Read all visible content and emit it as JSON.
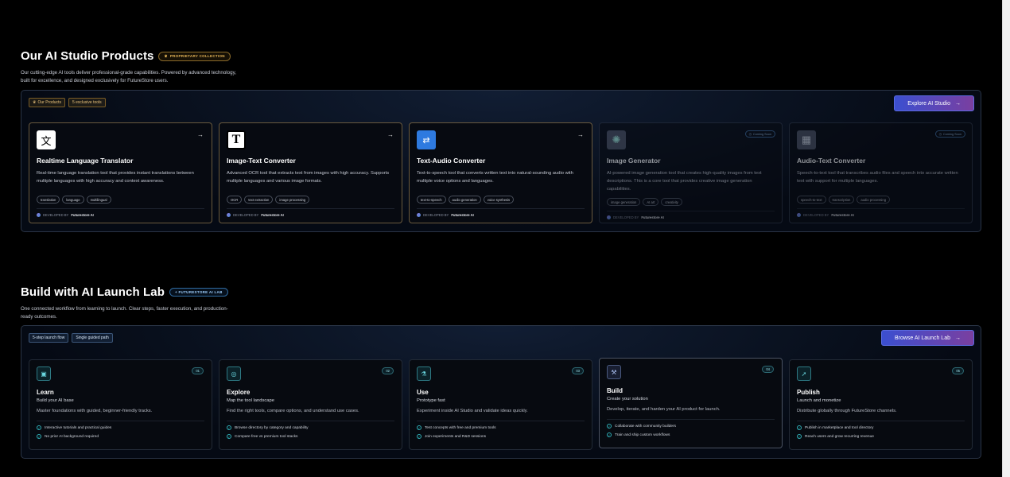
{
  "products": {
    "title": "Our AI Studio Products",
    "badge": "PROPRIETARY COLLECTION",
    "desc_line1": "Our cutting-edge AI tools deliver professional-grade capabilities. Powered by advanced technology,",
    "desc_line2": "built for excellence, and designed exclusively for FutureStore users.",
    "tag1": "Our Products",
    "tag2": "5 exclusive tools",
    "cta": "Explore AI Studio",
    "developed_by": "DEVELOPED BY",
    "developer": "Futurestore AI",
    "coming_soon": "Coming Soon",
    "cards": [
      {
        "title": "Realtime Language Translator",
        "desc": "Real-time language translation tool that provides instant translations between multiple languages with high accuracy and context awareness.",
        "chips": [
          "translation",
          "language",
          "multilingual"
        ],
        "icon": "translate-icon"
      },
      {
        "title": "Image-Text Converter",
        "desc": "Advanced OCR tool that extracts text from images with high accuracy. Supports multiple languages and various image formats.",
        "chips": [
          "OCR",
          "text extraction",
          "image processing"
        ],
        "icon": "ocr-text-icon"
      },
      {
        "title": "Text-Audio Converter",
        "desc": "Text-to-speech tool that converts written text into natural-sounding audio with multiple voice options and languages.",
        "chips": [
          "text-to-speech",
          "audio generation",
          "voice synthesis"
        ],
        "icon": "text-audio-icon"
      },
      {
        "title": "Image Generator",
        "desc": "AI-powered image generation tool that creates high-quality images from text descriptions. This is a core tool that provides creative image generation capabilities.",
        "chips": [
          "image generation",
          "AI art",
          "creativity"
        ],
        "icon": "image-gen-icon"
      },
      {
        "title": "Audio-Text Converter",
        "desc": "Speech-to-text tool that transcribes audio files and speech into accurate written text with support for multiple languages.",
        "chips": [
          "speech-to-text",
          "transcription",
          "audio processing"
        ],
        "icon": "audio-text-icon"
      }
    ]
  },
  "lab": {
    "title": "Build with AI Launch Lab",
    "badge": "FUTURESTORE AI LAB",
    "desc_line1": "One connected workflow from learning to launch. Clear steps, faster execution, and production-",
    "desc_line2": "ready outcomes.",
    "tag1": "5-step launch flow",
    "tag2": "Single guided path",
    "cta": "Browse AI Launch Lab",
    "steps": [
      {
        "num": "01",
        "title": "Learn",
        "sub": "Build your AI base",
        "desc": "Master foundations with guided, beginner-friendly tracks.",
        "items": [
          "Interactive tutorials and practical guides",
          "No prior AI background required"
        ],
        "icon": "book-icon"
      },
      {
        "num": "02",
        "title": "Explore",
        "sub": "Map the tool landscape",
        "desc": "Find the right tools, compare options, and understand use cases.",
        "items": [
          "Browse directory by category and capability",
          "Compare free vs premium tool stacks"
        ],
        "icon": "compass-icon"
      },
      {
        "num": "03",
        "title": "Use",
        "sub": "Prototype fast",
        "desc": "Experiment inside AI Studio and validate ideas quickly.",
        "items": [
          "Test concepts with free and premium tools",
          "Join experiments and R&D sessions"
        ],
        "icon": "flask-icon"
      },
      {
        "num": "04",
        "title": "Build",
        "sub": "Create your solution",
        "desc": "Develop, iterate, and harden your AI product for launch.",
        "items": [
          "Collaborate with community builders",
          "Train and ship custom workflows"
        ],
        "icon": "wrench-icon"
      },
      {
        "num": "05",
        "title": "Publish",
        "sub": "Launch and monetize",
        "desc": "Distribute globally through FutureStore channels.",
        "items": [
          "Publish in marketplace and tool directory",
          "Reach users and grow recurring revenue"
        ],
        "icon": "rocket-icon"
      }
    ]
  }
}
